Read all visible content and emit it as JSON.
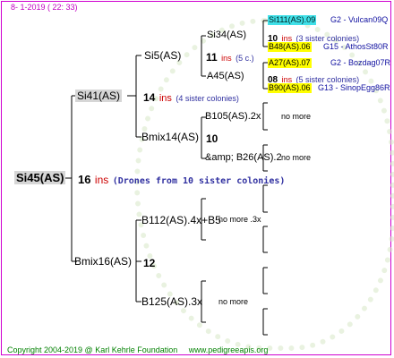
{
  "header": {
    "date_line": "8-  1-2019 ( 22: 33)"
  },
  "footer": {
    "copyright": "Copyright 2004-2019 @ Karl Kehrle Foundation",
    "website": "www.pedigreeapis.org"
  },
  "root": {
    "name": "Si45(AS)",
    "number": "16",
    "ins": "ins",
    "note": "(Drones from 10 sister colonies)"
  },
  "gen1": {
    "dam": {
      "name": "Si41(AS)",
      "number": "14",
      "ins": "ins",
      "note": "(4 sister colonies)"
    },
    "sire": {
      "name": "Bmix16(AS)",
      "number": "12"
    }
  },
  "gen2": {
    "dam_dam": {
      "name": "Si5(AS)",
      "number": "11",
      "ins": "ins",
      "note": "(5 c.)"
    },
    "dam_sire": {
      "name": "Bmix14(AS)",
      "number": "10"
    },
    "sire_dam": {
      "name": "B112(AS).4x+B5",
      "extra": "no more .3x"
    },
    "sire_sire": {
      "name": "B125(AS).3x",
      "extra": "no more"
    }
  },
  "gen3": {
    "si34": {
      "name": "Si34(AS)",
      "number": "10",
      "ins": "ins",
      "note": "(3 sister colonies)"
    },
    "a45": {
      "name": "A45(AS)",
      "number": "08",
      "ins": "ins",
      "note": "(5 sister colonies)"
    },
    "b105": {
      "name": "B105(AS).2x",
      "extra": "no more"
    },
    "b26": {
      "name": "&amp; B26(AS).2",
      "extra": "no more"
    }
  },
  "gen4": [
    {
      "name": "Si111(AS).09",
      "origin": "G2 - Vulcan09Q"
    },
    {
      "name": "B48(AS).06",
      "origin": "G15 - AthosSt80R"
    },
    {
      "name": "A27(AS).07",
      "origin": "G2 - Bozdag07R"
    },
    {
      "name": "B90(AS).06",
      "origin": "G13 - SinopEgg86R"
    }
  ],
  "colors": {
    "frame": "#d000d0",
    "ins": "#cc0000",
    "note": "#3030a0",
    "cyan": "#40e0e8",
    "yellow": "#ffff00",
    "footer": "#008000"
  }
}
